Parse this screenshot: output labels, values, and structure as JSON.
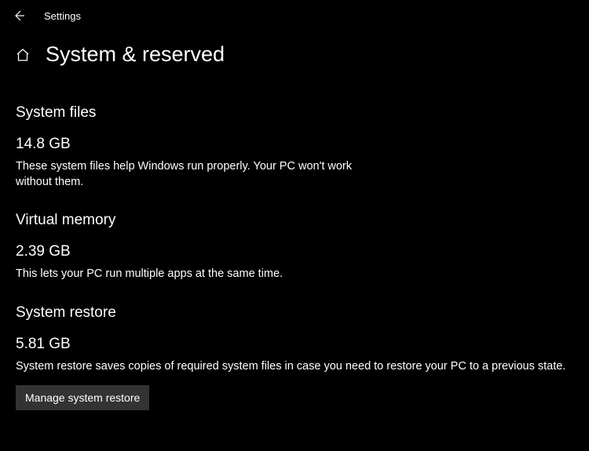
{
  "header": {
    "title": "Settings"
  },
  "page": {
    "title": "System & reserved"
  },
  "sections": {
    "system_files": {
      "heading": "System files",
      "value": "14.8 GB",
      "desc": "These system files help Windows run properly. Your PC won't work without them."
    },
    "virtual_memory": {
      "heading": "Virtual memory",
      "value": "2.39 GB",
      "desc": "This lets your PC run multiple apps at the same time."
    },
    "system_restore": {
      "heading": "System restore",
      "value": "5.81 GB",
      "desc": "System restore saves copies of required system files in case you need to restore your PC to a previous state.",
      "button_label": "Manage system restore"
    }
  }
}
